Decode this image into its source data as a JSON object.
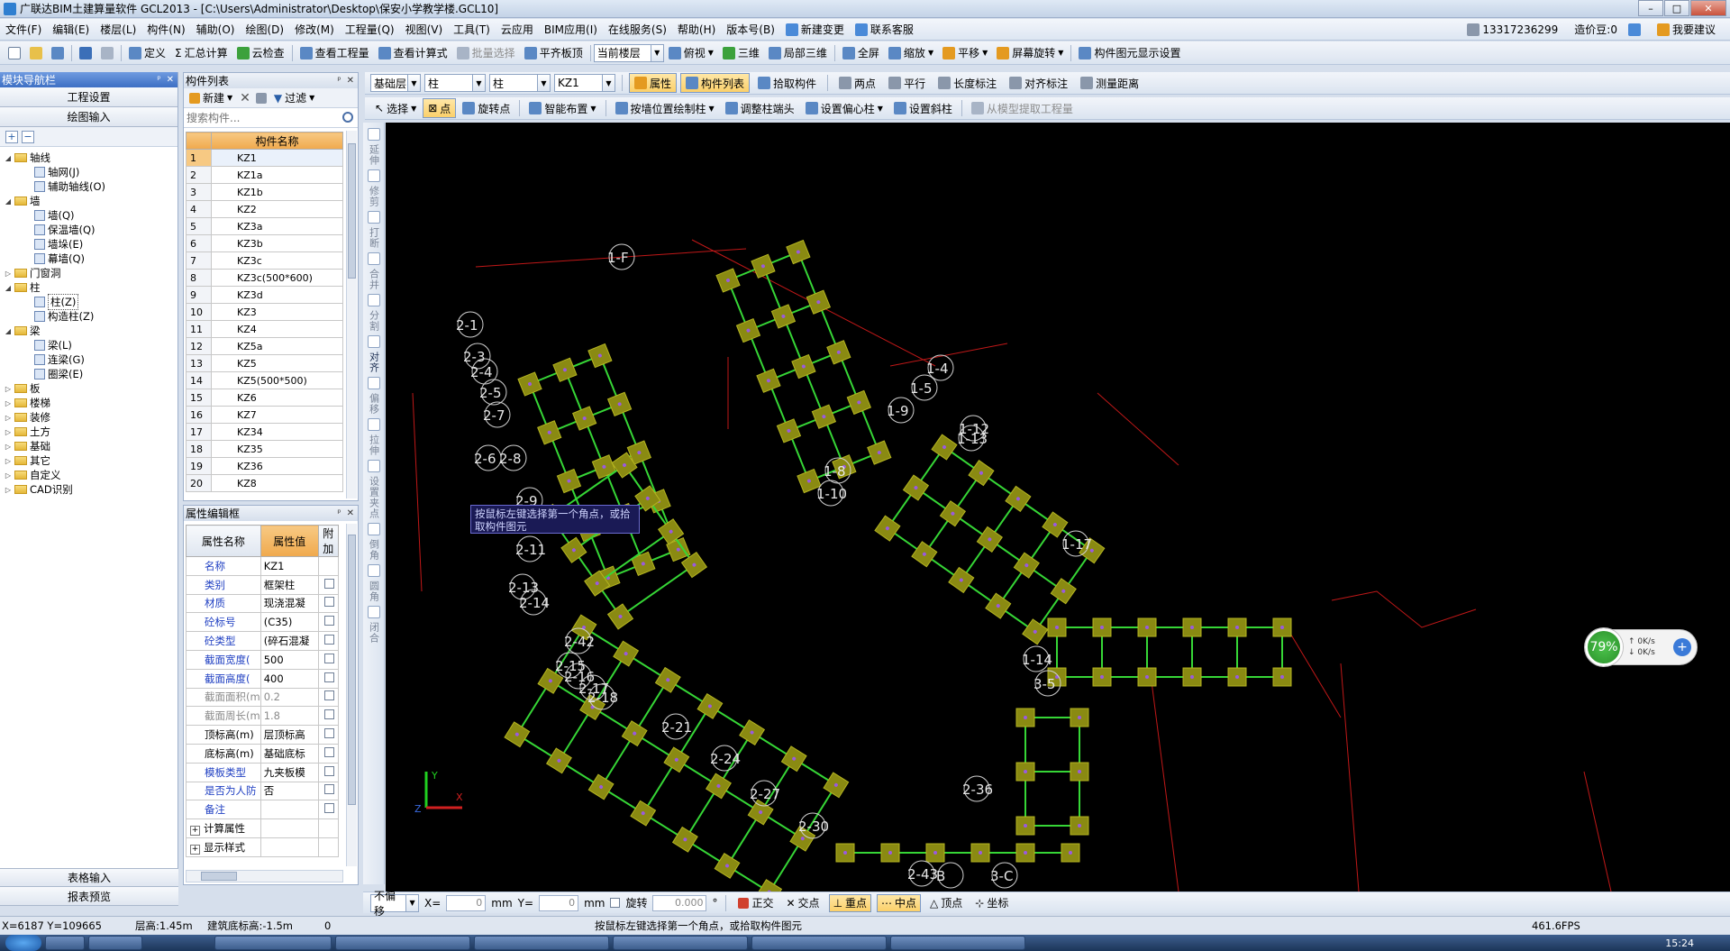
{
  "window": {
    "title": "广联达BIM土建算量软件 GCL2013 - [C:\\Users\\Administrator\\Desktop\\保安小学教学楼.GCL10]"
  },
  "menu": {
    "items": [
      "文件(F)",
      "编辑(E)",
      "楼层(L)",
      "构件(N)",
      "辅助(O)",
      "绘图(D)",
      "修改(M)",
      "工程量(Q)",
      "视图(V)",
      "工具(T)",
      "云应用",
      "BIM应用(I)",
      "在线服务(S)",
      "帮助(H)",
      "版本号(B)"
    ],
    "new_change": "新建变更",
    "contact": "联系客服",
    "phone": "13317236299",
    "bean": "造价豆:0",
    "suggest": "我要建议"
  },
  "toolbar": {
    "define": "定义",
    "sum": "汇总计算",
    "cloud_check": "云检查",
    "view_qty": "查看工程量",
    "view_formula": "查看计算式",
    "batch_select": "批量选择",
    "flat_slab": "平齐板顶",
    "floor_select": "当前楼层",
    "top_view": "俯视",
    "three_d": "三维",
    "local_3d": "局部三维",
    "fullscreen": "全屏",
    "zoom": "缩放",
    "pan": "平移",
    "screen_rotate": "屏幕旋转",
    "display_settings": "构件图元显示设置"
  },
  "nav": {
    "header": "模块导航栏",
    "project_settings": "工程设置",
    "drawing_input": "绘图输入",
    "tree": [
      {
        "label": "轴线",
        "level": 0,
        "type": "folder",
        "open": true
      },
      {
        "label": "轴网(J)",
        "level": 1,
        "type": "leaf"
      },
      {
        "label": "辅助轴线(O)",
        "level": 1,
        "type": "leaf"
      },
      {
        "label": "墙",
        "level": 0,
        "type": "folder",
        "open": true
      },
      {
        "label": "墙(Q)",
        "level": 1,
        "type": "leaf"
      },
      {
        "label": "保温墙(Q)",
        "level": 1,
        "type": "leaf"
      },
      {
        "label": "墙垛(E)",
        "level": 1,
        "type": "leaf"
      },
      {
        "label": "幕墙(Q)",
        "level": 1,
        "type": "leaf"
      },
      {
        "label": "门窗洞",
        "level": 0,
        "type": "folder",
        "open": false
      },
      {
        "label": "柱",
        "level": 0,
        "type": "folder",
        "open": true
      },
      {
        "label": "柱(Z)",
        "level": 1,
        "type": "leaf"
      },
      {
        "label": "构造柱(Z)",
        "level": 1,
        "type": "leaf"
      },
      {
        "label": "梁",
        "level": 0,
        "type": "folder",
        "open": true
      },
      {
        "label": "梁(L)",
        "level": 1,
        "type": "leaf"
      },
      {
        "label": "连梁(G)",
        "level": 1,
        "type": "leaf"
      },
      {
        "label": "圈梁(E)",
        "level": 1,
        "type": "leaf"
      },
      {
        "label": "板",
        "level": 0,
        "type": "folder",
        "open": false
      },
      {
        "label": "楼梯",
        "level": 0,
        "type": "folder",
        "open": false
      },
      {
        "label": "装修",
        "level": 0,
        "type": "folder",
        "open": false
      },
      {
        "label": "土方",
        "level": 0,
        "type": "folder",
        "open": false
      },
      {
        "label": "基础",
        "level": 0,
        "type": "folder",
        "open": false
      },
      {
        "label": "其它",
        "level": 0,
        "type": "folder",
        "open": false
      },
      {
        "label": "自定义",
        "level": 0,
        "type": "folder",
        "open": false
      },
      {
        "label": "CAD识别",
        "level": 0,
        "type": "folder",
        "open": false
      }
    ],
    "table_input": "表格输入",
    "report_preview": "报表预览"
  },
  "component_list": {
    "header": "构件列表",
    "new_btn": "新建",
    "filter_btn": "过滤",
    "search_placeholder": "搜索构件...",
    "column": "构件名称",
    "rows": [
      "KZ1",
      "KZ1a",
      "KZ1b",
      "KZ2",
      "KZ3a",
      "KZ3b",
      "KZ3c",
      "KZ3c(500*600)",
      "KZ3d",
      "KZ3",
      "KZ4",
      "KZ5a",
      "KZ5",
      "KZ5(500*500)",
      "KZ6",
      "KZ7",
      "KZ34",
      "KZ35",
      "KZ36",
      "KZ8"
    ]
  },
  "properties": {
    "header": "属性编辑框",
    "col_name": "属性名称",
    "col_value": "属性值",
    "col_extra": "附加",
    "rows": [
      {
        "k": "名称",
        "v": "KZ1",
        "style": "blue",
        "check": false
      },
      {
        "k": "类别",
        "v": "框架柱",
        "style": "blue",
        "check": true
      },
      {
        "k": "材质",
        "v": "现浇混凝",
        "style": "blue",
        "check": true
      },
      {
        "k": "砼标号",
        "v": "(C35)",
        "style": "blue",
        "check": true
      },
      {
        "k": "砼类型",
        "v": "(碎石混凝",
        "style": "blue",
        "check": true
      },
      {
        "k": "截面宽度(",
        "v": "500",
        "style": "blue",
        "check": true
      },
      {
        "k": "截面高度(",
        "v": "400",
        "style": "blue",
        "check": true
      },
      {
        "k": "截面面积(m",
        "v": "0.2",
        "style": "gray",
        "check": true
      },
      {
        "k": "截面周长(m",
        "v": "1.8",
        "style": "gray",
        "check": true
      },
      {
        "k": "顶标高(m)",
        "v": "层顶标高",
        "style": "black",
        "check": true
      },
      {
        "k": "底标高(m)",
        "v": "基础底标",
        "style": "black",
        "check": true
      },
      {
        "k": "模板类型",
        "v": "九夹板模",
        "style": "blue",
        "check": true
      },
      {
        "k": "是否为人防",
        "v": "否",
        "style": "blue",
        "check": true
      },
      {
        "k": "备注",
        "v": "",
        "style": "blue",
        "check": true
      }
    ],
    "group1": "计算属性",
    "group2": "显示样式"
  },
  "drawbar": {
    "floor": "基础层",
    "type1": "柱",
    "type2": "柱",
    "component": "KZ1",
    "property": "属性",
    "comp_list": "构件列表",
    "pick": "拾取构件",
    "two_point": "两点",
    "parallel": "平行",
    "angle_mark": "长度标注",
    "align_mark": "对齐标注",
    "measure": "测量距离",
    "select": "选择",
    "point": "点",
    "rotate_point": "旋转点",
    "smart_layout": "智能布置",
    "draw_by_wall": "按墙位置绘制柱",
    "adjust_head": "调整柱端头",
    "set_offset": "设置偏心柱",
    "set_slope": "设置斜柱",
    "extract": "从模型提取工程量"
  },
  "vtools": [
    "延伸",
    "修剪",
    "打断",
    "合并",
    "分割",
    "对齐",
    "偏移",
    "拉伸",
    "设置夹点",
    "倒角",
    "圆角",
    "闭合"
  ],
  "canvas": {
    "tooltip": "按鼠标左键选择第一个角点，或拾取构件图元",
    "axis_labels": [
      "1-F",
      "2-1",
      "2-3",
      "2-4",
      "2-5",
      "2-7",
      "2-6",
      "2-8",
      "1-4",
      "1-5",
      "1-9",
      "1-12",
      "1-13",
      "1-8",
      "1-10",
      "2-9",
      "2-11",
      "2-13",
      "2-14",
      "1-17",
      "2-42",
      "2-15",
      "2-16",
      "2-17",
      "2-18",
      "2-21",
      "2-24",
      "2-27",
      "2-30",
      "2-36",
      "2-43",
      "1-14",
      "3-5",
      "3-C",
      "B"
    ],
    "net_pct": "79%",
    "net_up": "0K/s",
    "net_down": "0K/s"
  },
  "snapbar": {
    "no_offset": "不偏移",
    "x_label": "X=",
    "x_val": "0",
    "y_label": "Y=",
    "y_val": "0",
    "mm1": "mm",
    "mm2": "mm",
    "rotate": "旋转",
    "rotate_val": "0.000",
    "ortho": "正交",
    "intersect": "交点",
    "perp": "重点",
    "mid": "中点",
    "vertex": "顶点",
    "coord": "坐标"
  },
  "status": {
    "coords": "X=6187 Y=109665",
    "floor_height": "层高:1.45m",
    "bottom_elev": "建筑底标高:-1.5m",
    "zero": "0",
    "hint": "按鼠标左键选择第一个角点，或拾取构件图元",
    "fps": "461.6FPS"
  },
  "taskbar": {
    "clock": "15:24"
  }
}
